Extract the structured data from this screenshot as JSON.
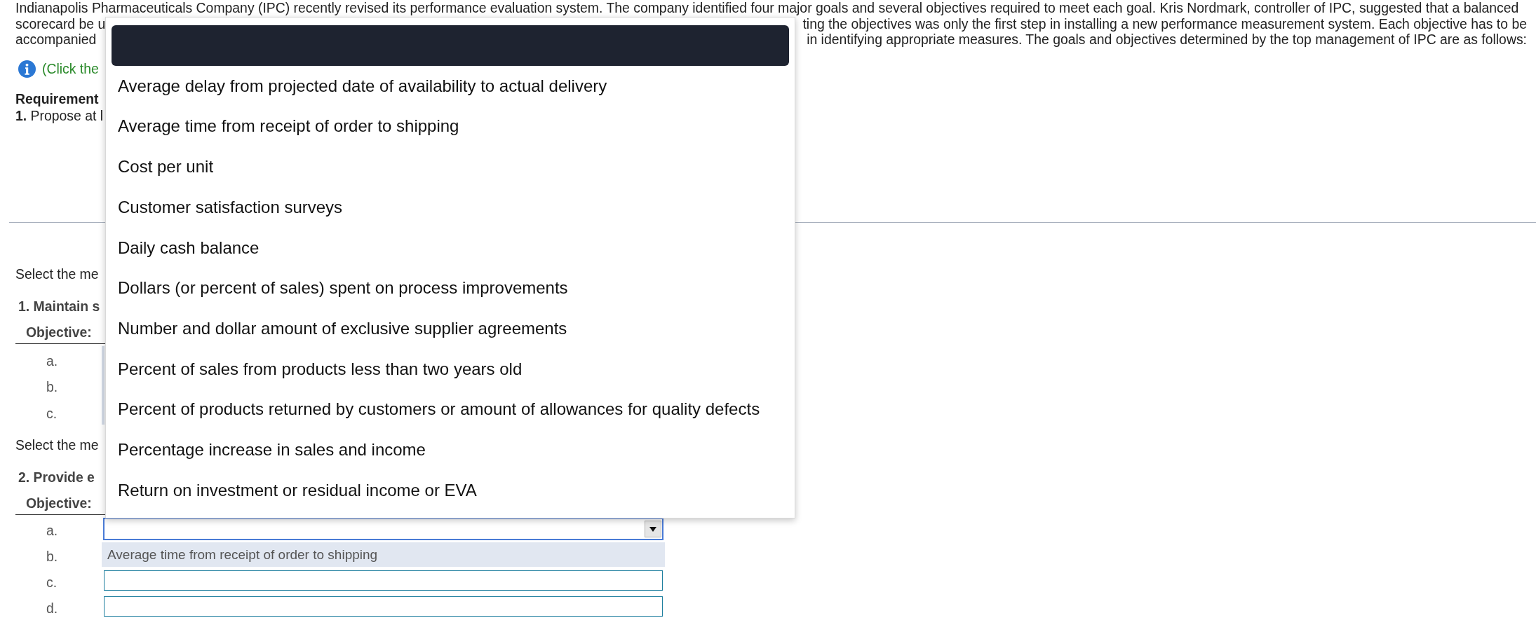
{
  "intro": {
    "lines": [
      {
        "segments": [
          "Indianapolis Pharmaceuticals Company (IPC) recently revised its performance evaluation system. The company identified four major goals and several objectives required to meet each goal. Kris Nordmark, controller of IPC, suggested that a balanced"
        ]
      },
      {
        "segments": [
          "scorecard be u",
          "ting the objectives was only the first step in installing a new performance measurement system. Each objective has to be"
        ]
      },
      {
        "segments": [
          "accompanied",
          "in identifying appropriate measures. The goals and objectives determined by the top management of IPC are as follows:"
        ]
      }
    ]
  },
  "hint": {
    "text": "(Click the"
  },
  "requirements": {
    "heading": "Requirement",
    "items": [
      "**1.** Propose at l"
    ]
  },
  "sections": [
    {
      "instruction": "Select the me",
      "title": "1. Maintain s",
      "objective_label": "Objective:",
      "rows": [
        {
          "label": "a.",
          "kind": "covered"
        },
        {
          "label": "b.",
          "kind": "covered"
        },
        {
          "label": "c.",
          "kind": "covered"
        }
      ]
    },
    {
      "instruction": "Select the me",
      "title": "2. Provide e",
      "objective_label": "Objective:",
      "rows": [
        {
          "label": "a.",
          "kind": "select",
          "focused": true,
          "expanded": true,
          "options": [
            {
              "kind": "blank",
              "selected": true
            },
            {
              "kind": "text",
              "label": "Average delay from projected date of availability to actual delivery",
              "selected": false
            },
            {
              "kind": "text",
              "label": "Average time from receipt of order to shipping",
              "selected": false
            },
            {
              "kind": "text",
              "label": "Cost per unit",
              "selected": false
            },
            {
              "kind": "text",
              "label": "Customer satisfaction surveys",
              "selected": false
            },
            {
              "kind": "text",
              "label": "Daily cash balance",
              "selected": false
            },
            {
              "kind": "text",
              "label": "Dollars (or percent of sales) spent on process improvements",
              "selected": false
            },
            {
              "kind": "text",
              "label": "Number and dollar amount of exclusive supplier agreements",
              "selected": false
            },
            {
              "kind": "text",
              "label": "Percent of sales from products less than two years old",
              "selected": false
            },
            {
              "kind": "text",
              "label": "Percent of products returned by customers or amount of allowances for quality defects",
              "selected": false
            },
            {
              "kind": "text",
              "label": "Percentage increase in sales and income",
              "selected": false
            },
            {
              "kind": "text",
              "label": "Return on investment or residual income or EVA",
              "selected": false
            }
          ]
        },
        {
          "label": "b.",
          "kind": "filled",
          "value": "Average time from receipt of order to shipping"
        },
        {
          "label": "c.",
          "kind": "input"
        },
        {
          "label": "d.",
          "kind": "input"
        }
      ]
    }
  ]
}
